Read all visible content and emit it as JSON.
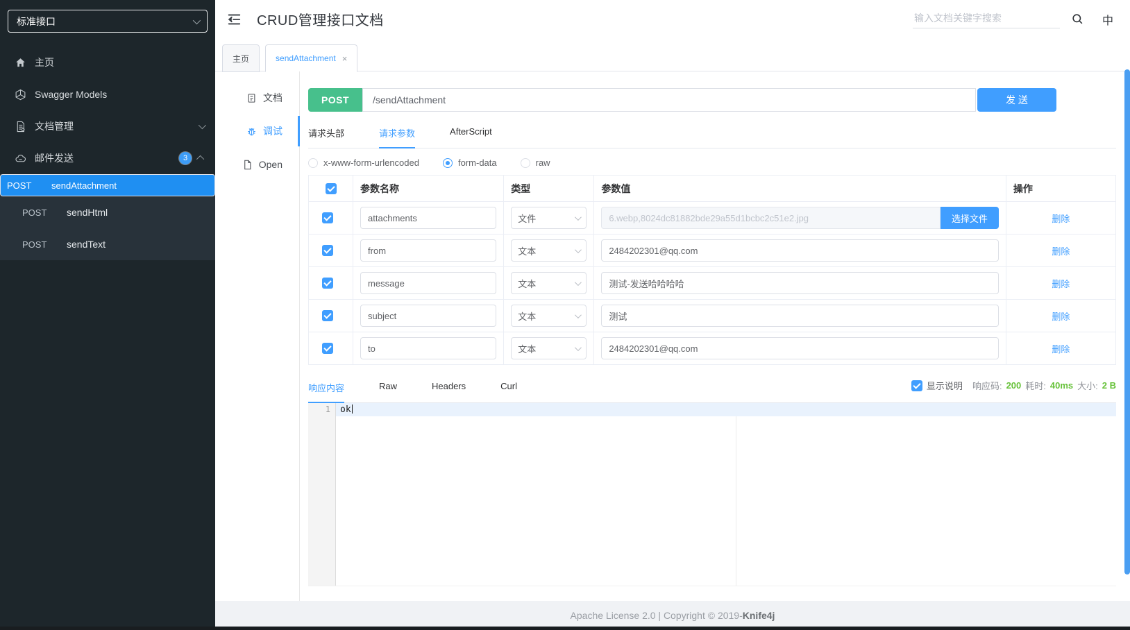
{
  "sidebar": {
    "group_select": {
      "value": "标准接口"
    },
    "items": [
      {
        "label": "主页",
        "icon": "home-icon"
      },
      {
        "label": "Swagger Models",
        "icon": "models-icon"
      },
      {
        "label": "文档管理",
        "icon": "document-manage-icon",
        "chevron": "down"
      },
      {
        "label": "邮件发送",
        "icon": "mail-send-icon",
        "badge": "3",
        "chevron": "up"
      }
    ],
    "submenu": [
      {
        "method": "POST",
        "name": "sendAttachment",
        "selected": true
      },
      {
        "method": "POST",
        "name": "sendHtml",
        "selected": false
      },
      {
        "method": "POST",
        "name": "sendText",
        "selected": false
      }
    ]
  },
  "header": {
    "title": "CRUD管理接口文档",
    "search_placeholder": "输入文档关键字搜索",
    "lang": "中"
  },
  "tabs": [
    {
      "label": "主页",
      "active": false
    },
    {
      "label": "sendAttachment",
      "active": true,
      "close": "×"
    }
  ],
  "doc_nav": [
    {
      "label": "文档",
      "icon": "doc-icon"
    },
    {
      "label": "调试",
      "icon": "bug-icon",
      "active": true
    },
    {
      "label": "Open",
      "icon": "open-file-icon"
    }
  ],
  "debug": {
    "method": "POST",
    "url": "/sendAttachment",
    "send_label": "发 送",
    "request_tabs": [
      "请求头部",
      "请求参数",
      "AfterScript"
    ],
    "content_types": [
      {
        "label": "x-www-form-urlencoded",
        "checked": false
      },
      {
        "label": "form-data",
        "checked": true
      },
      {
        "label": "raw",
        "checked": false
      }
    ],
    "table": {
      "headers": [
        "参数名称",
        "类型",
        "参数值",
        "操作"
      ],
      "rows": [
        {
          "name": "attachments",
          "type": "文件",
          "value": "6.webp,8024dc81882bde29a55d1bcbc2c51e2.jpg",
          "file_button": "选择文件",
          "action": "删除"
        },
        {
          "name": "from",
          "type": "文本",
          "value": "2484202301@qq.com",
          "action": "删除"
        },
        {
          "name": "message",
          "type": "文本",
          "value": "测试-发送哈哈哈哈",
          "action": "删除"
        },
        {
          "name": "subject",
          "type": "文本",
          "value": "测试",
          "action": "删除"
        },
        {
          "name": "to",
          "type": "文本",
          "value": "2484202301@qq.com",
          "action": "删除"
        }
      ]
    },
    "response_tabs": [
      "响应内容",
      "Raw",
      "Headers",
      "Curl"
    ],
    "show_desc_label": "显示说明",
    "status": {
      "code_label": "响应码:",
      "code": "200",
      "time_label": "耗时:",
      "time": "40ms",
      "size_label": "大小:",
      "size": "2 B"
    },
    "editor": {
      "line_number": "1",
      "content": "ok"
    }
  },
  "footer": {
    "text": "Apache License 2.0 | Copyright © 2019-",
    "brand": "Knife4j"
  },
  "colors": {
    "accent": "#409eff",
    "method_post_green": "#47c08c",
    "status_success_green": "#67c23a",
    "selected_menu_blue": "#1f8ff2",
    "sidebar_bg": "#1d262b"
  }
}
